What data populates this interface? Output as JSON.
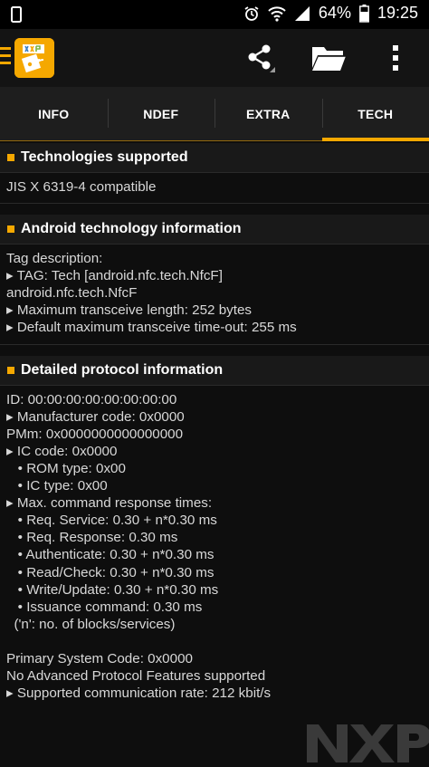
{
  "status_bar": {
    "battery_pct": "64%",
    "time": "19:25"
  },
  "tabs": [
    {
      "label": "INFO",
      "active": false
    },
    {
      "label": "NDEF",
      "active": false
    },
    {
      "label": "EXTRA",
      "active": false
    },
    {
      "label": "TECH",
      "active": true
    }
  ],
  "sections": [
    {
      "title": "Technologies supported",
      "lines": [
        "JIS X 6319-4 compatible"
      ]
    },
    {
      "title": "Android technology information",
      "lines": [
        "Tag description:",
        "▸ TAG: Tech [android.nfc.tech.NfcF]",
        "android.nfc.tech.NfcF",
        "▸ Maximum transceive length: 252 bytes",
        "▸ Default maximum transceive time-out: 255 ms"
      ]
    },
    {
      "title": "Detailed protocol information",
      "lines": [
        "ID: 00:00:00:00:00:00:00:00",
        "▸ Manufacturer code: 0x0000",
        "PMm: 0x0000000000000000",
        "▸ IC code: 0x0000",
        "   • ROM type: 0x00",
        "   • IC type: 0x00",
        "▸ Max. command response times:",
        "   • Req. Service: 0.30 + n*0.30 ms",
        "   • Req. Response: 0.30 ms",
        "   • Authenticate: 0.30 + n*0.30 ms",
        "   • Read/Check: 0.30 + n*0.30 ms",
        "   • Write/Update: 0.30 + n*0.30 ms",
        "   • Issuance command: 0.30 ms",
        "  ('n': no. of blocks/services)",
        "",
        "Primary System Code: 0x0000",
        "No Advanced Protocol Features supported",
        "▸ Supported communication rate: 212 kbit/s"
      ]
    }
  ],
  "colors": {
    "accent": "#f5a800",
    "background": "#0e0e0e",
    "section_header": "#191919"
  },
  "icons": {
    "status_left": "phone-icon",
    "alarm": "alarm-icon",
    "wifi": "wifi-icon",
    "signal": "signal-icon",
    "battery": "battery-icon",
    "menu": "hamburger-icon",
    "share": "share-icon",
    "folder": "folder-icon",
    "overflow": "more-vert-icon"
  }
}
